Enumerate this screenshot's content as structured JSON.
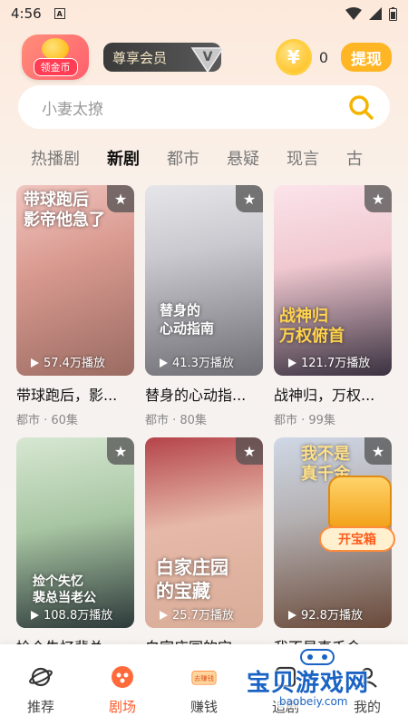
{
  "status_bar": {
    "time": "4:56",
    "sim_label": "A"
  },
  "header": {
    "gold_badge_label": "领金币",
    "vip_label": "尊享会员",
    "vip_letter": "V",
    "coin_symbol": "¥",
    "coin_count": "0",
    "withdraw_label": "提现"
  },
  "search": {
    "placeholder": "小妻太撩"
  },
  "tabs": [
    {
      "label": "热播剧"
    },
    {
      "label": "新剧"
    },
    {
      "label": "都市"
    },
    {
      "label": "悬疑"
    },
    {
      "label": "现言"
    },
    {
      "label": "古"
    }
  ],
  "active_tab": "新剧",
  "dramas": [
    {
      "title": "带球跑后，影...",
      "meta": "都市 · 60集",
      "plays": "57.4万播放",
      "poster_text": "带球跑后\n影帝他急了"
    },
    {
      "title": "替身的心动指...",
      "meta": "都市 · 80集",
      "plays": "41.3万播放",
      "poster_text": "替身的\n心动指南"
    },
    {
      "title": "战神归，万权...",
      "meta": "都市 · 99集",
      "plays": "121.7万播放",
      "poster_text": "战神归\n万权俯首"
    },
    {
      "title": "捡个失忆裴总...",
      "meta": "",
      "plays": "108.8万播放",
      "poster_text": "捡个失忆\n裴总当老公"
    },
    {
      "title": "白家庄园的宝...",
      "meta": "",
      "plays": "25.7万播放",
      "poster_text": "白家庄园\n的宝藏"
    },
    {
      "title": "我不是真千金",
      "meta": "",
      "plays": "92.8万播放",
      "poster_text": "我不是\n真千金"
    }
  ],
  "treasure_label": "开宝箱",
  "bottom_nav": [
    {
      "label": "推荐",
      "icon": "planet-icon"
    },
    {
      "label": "剧场",
      "icon": "theater-icon"
    },
    {
      "label": "赚钱",
      "icon": "earn-icon",
      "badge": "去赚钱"
    },
    {
      "label": "追剧",
      "icon": "follow-icon"
    },
    {
      "label": "我的",
      "icon": "profile-icon"
    }
  ],
  "watermark": {
    "title": "宝贝游戏网",
    "url": "baobeiy.com"
  },
  "colors": {
    "accent": "#ff5a2a",
    "gold": "#ffb524",
    "search_icon": "#f5b400"
  }
}
